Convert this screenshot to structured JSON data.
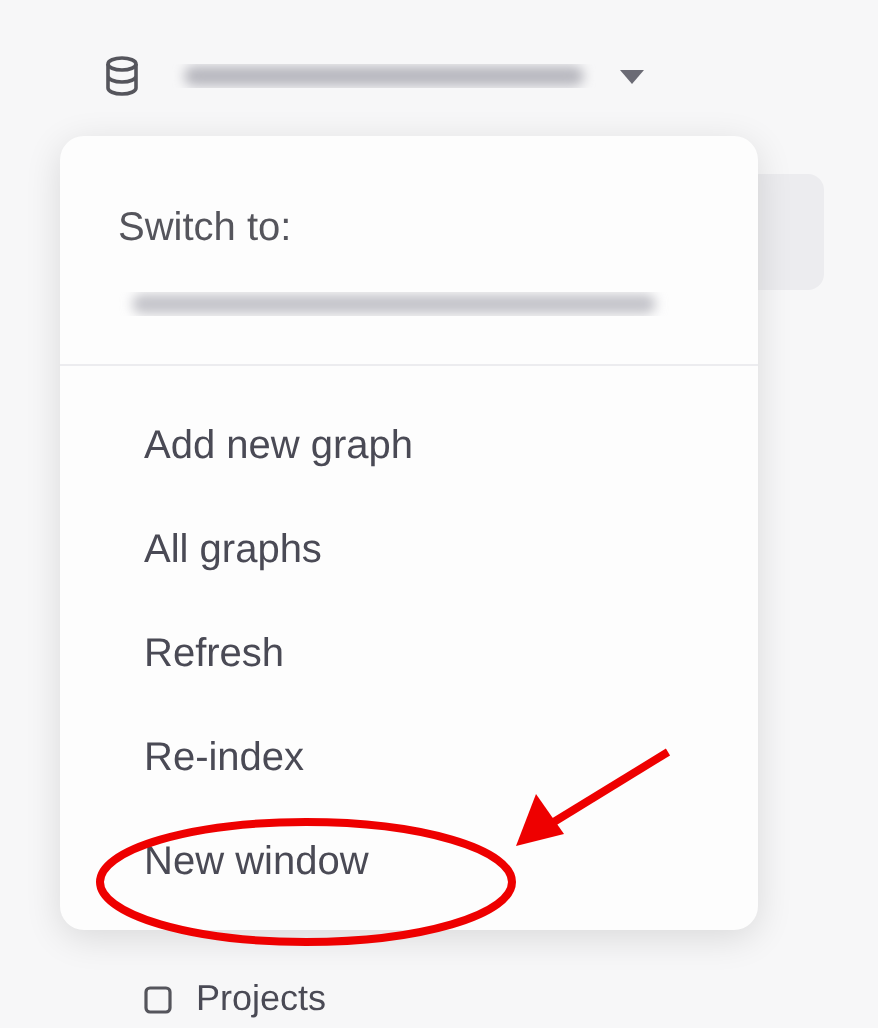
{
  "graph_switcher": {
    "expanded": true
  },
  "menu": {
    "heading": "Switch to:",
    "items": [
      {
        "label": "Add new graph"
      },
      {
        "label": "All graphs"
      },
      {
        "label": "Refresh"
      },
      {
        "label": "Re-index"
      },
      {
        "label": "New window"
      }
    ]
  },
  "sidebar": {
    "items": [
      {
        "label": "Projects"
      }
    ]
  }
}
